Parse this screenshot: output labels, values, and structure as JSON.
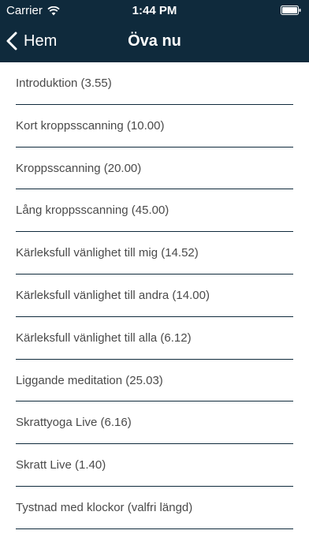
{
  "colors": {
    "header_bg": "#0f2a3c",
    "header_text": "#ffffff",
    "item_text": "#4a4a4a",
    "divider": "#0f2a3c"
  },
  "status_bar": {
    "carrier": "Carrier",
    "time": "1:44 PM",
    "wifi_icon": "wifi-icon",
    "battery_icon": "battery-icon"
  },
  "nav": {
    "back_label": "Hem",
    "back_icon": "chevron-left-icon",
    "title": "Öva nu"
  },
  "items": [
    {
      "label": "Introduktion (3.55)"
    },
    {
      "label": "Kort kroppsscanning (10.00)"
    },
    {
      "label": "Kroppsscanning (20.00)"
    },
    {
      "label": "Lång kroppsscanning (45.00)"
    },
    {
      "label": "Kärleksfull vänlighet till mig (14.52)"
    },
    {
      "label": "Kärleksfull vänlighet till andra (14.00)"
    },
    {
      "label": "Kärleksfull vänlighet till alla (6.12)"
    },
    {
      "label": "Liggande meditation (25.03)"
    },
    {
      "label": "Skrattyoga Live (6.16)"
    },
    {
      "label": "Skratt Live (1.40)"
    },
    {
      "label": "Tystnad med klockor (valfri längd)"
    }
  ]
}
